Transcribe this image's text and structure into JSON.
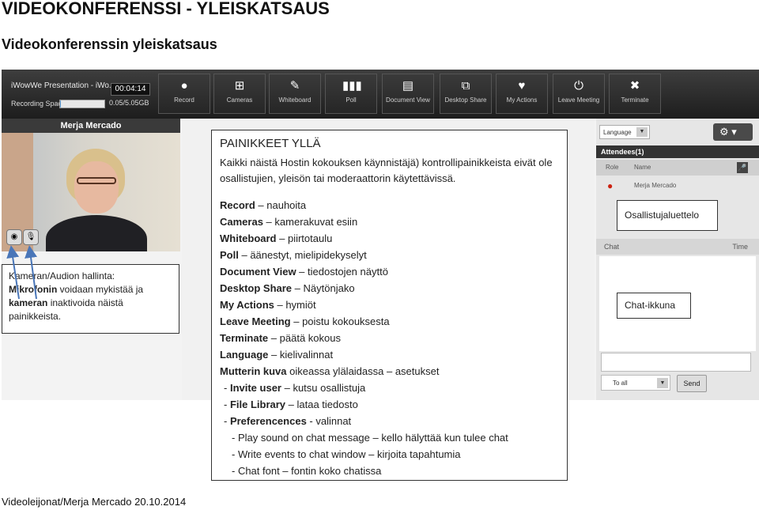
{
  "page": {
    "title": "VIDEOKONFERENSSI - YLEISKATSAUS",
    "subtitle": "Videokonferenssin yleiskatsaus",
    "footer": "Videoleijonat/Merja Mercado 20.10.2014"
  },
  "app": {
    "window_title": "iWowWe Presentation - iWo...",
    "timer": "00:04:14",
    "recording_space_label": "Recording Space:",
    "recording_space_value": "0.05/5.05GB",
    "recording_space_fraction": 0.01,
    "toolbar": [
      {
        "label": "Record",
        "icon": "record-icon"
      },
      {
        "label": "Cameras",
        "icon": "cameras-icon"
      },
      {
        "label": "Whiteboard",
        "icon": "whiteboard-icon"
      },
      {
        "label": "Poll",
        "icon": "poll-icon"
      },
      {
        "label": "Document View",
        "icon": "document-view-icon"
      },
      {
        "label": "Desktop Share",
        "icon": "desktop-share-icon"
      },
      {
        "label": "My Actions",
        "icon": "heart-icon"
      },
      {
        "label": "Leave Meeting",
        "icon": "power-icon"
      },
      {
        "label": "Terminate",
        "icon": "close-icon"
      }
    ],
    "video": {
      "participant_name": "Merja Mercado"
    },
    "right_panel": {
      "language_label": "Language",
      "attendees_header": "Attendees(1)",
      "columns": {
        "role": "Role",
        "name": "Name"
      },
      "attendees": [
        {
          "name": "Merja Mercado"
        }
      ],
      "chat_label": "Chat",
      "time_label": "Time",
      "to_all_label": "To all",
      "send_label": "Send"
    }
  },
  "callouts": {
    "main": {
      "header": "PAINIKKEET YLLÄ",
      "intro": "Kaikki näistä Hostin kokouksen käynnistäjä) kontrollipainikkeista eivät ole osallistujien, yleisön tai moderaattorin käytettävissä.",
      "lines": [
        {
          "term": "Record",
          "sep": " – ",
          "desc": "nauhoita"
        },
        {
          "term": "Cameras",
          "sep": " – ",
          "desc": "kamerakuvat esiin"
        },
        {
          "term": "Whiteboard",
          "sep": " – ",
          "desc": "piirtotaulu"
        },
        {
          "term": "Poll",
          "sep": " – ",
          "desc": "äänestyt, mielipidekyselyt"
        },
        {
          "term": "Document View",
          "sep": " – ",
          "desc": "tiedostojen näyttö"
        },
        {
          "term": "Desktop Share",
          "sep": " – ",
          "desc": "Näytönjako"
        },
        {
          "term": "My Actions",
          "sep": " – ",
          "desc": "hymiöt"
        },
        {
          "term": "Leave Meeting",
          "sep": " – ",
          "desc": "poistu kokouksesta"
        },
        {
          "term": "Terminate",
          "sep": " – ",
          "desc": "päätä kokous"
        },
        {
          "term": "Language",
          "sep": " – ",
          "desc": "kielivalinnat"
        },
        {
          "term": "Mutterin kuva",
          "sep": " ",
          "desc": "oikeassa ylälaidassa – asetukset"
        }
      ],
      "sub_lines": [
        {
          "prefix": "- ",
          "term": "Invite user",
          "sep": " – ",
          "desc": "kutsu osallistuja"
        },
        {
          "prefix": "- ",
          "term": "File Library",
          "sep": " – ",
          "desc": "lataa tiedosto"
        },
        {
          "prefix": "- ",
          "term": "Preferencences",
          "sep": " - ",
          "desc": "valinnat"
        }
      ],
      "pref_lines": [
        "- Play sound on chat message – kello hälyttää kun tulee chat",
        "- Write events to chat window – kirjoita tapahtumia",
        "- Chat font – fontin koko chatissa"
      ]
    },
    "camera": {
      "line1": "Kameran/Audion hallinta:",
      "term1": "Mikrofonin",
      "text1": " voidaan mykistää ja ",
      "term2": "kameran",
      "text2": " inaktivoida näistä painikkeista."
    },
    "participants": "Osallistujaluettelo",
    "chat": "Chat-ikkuna"
  }
}
